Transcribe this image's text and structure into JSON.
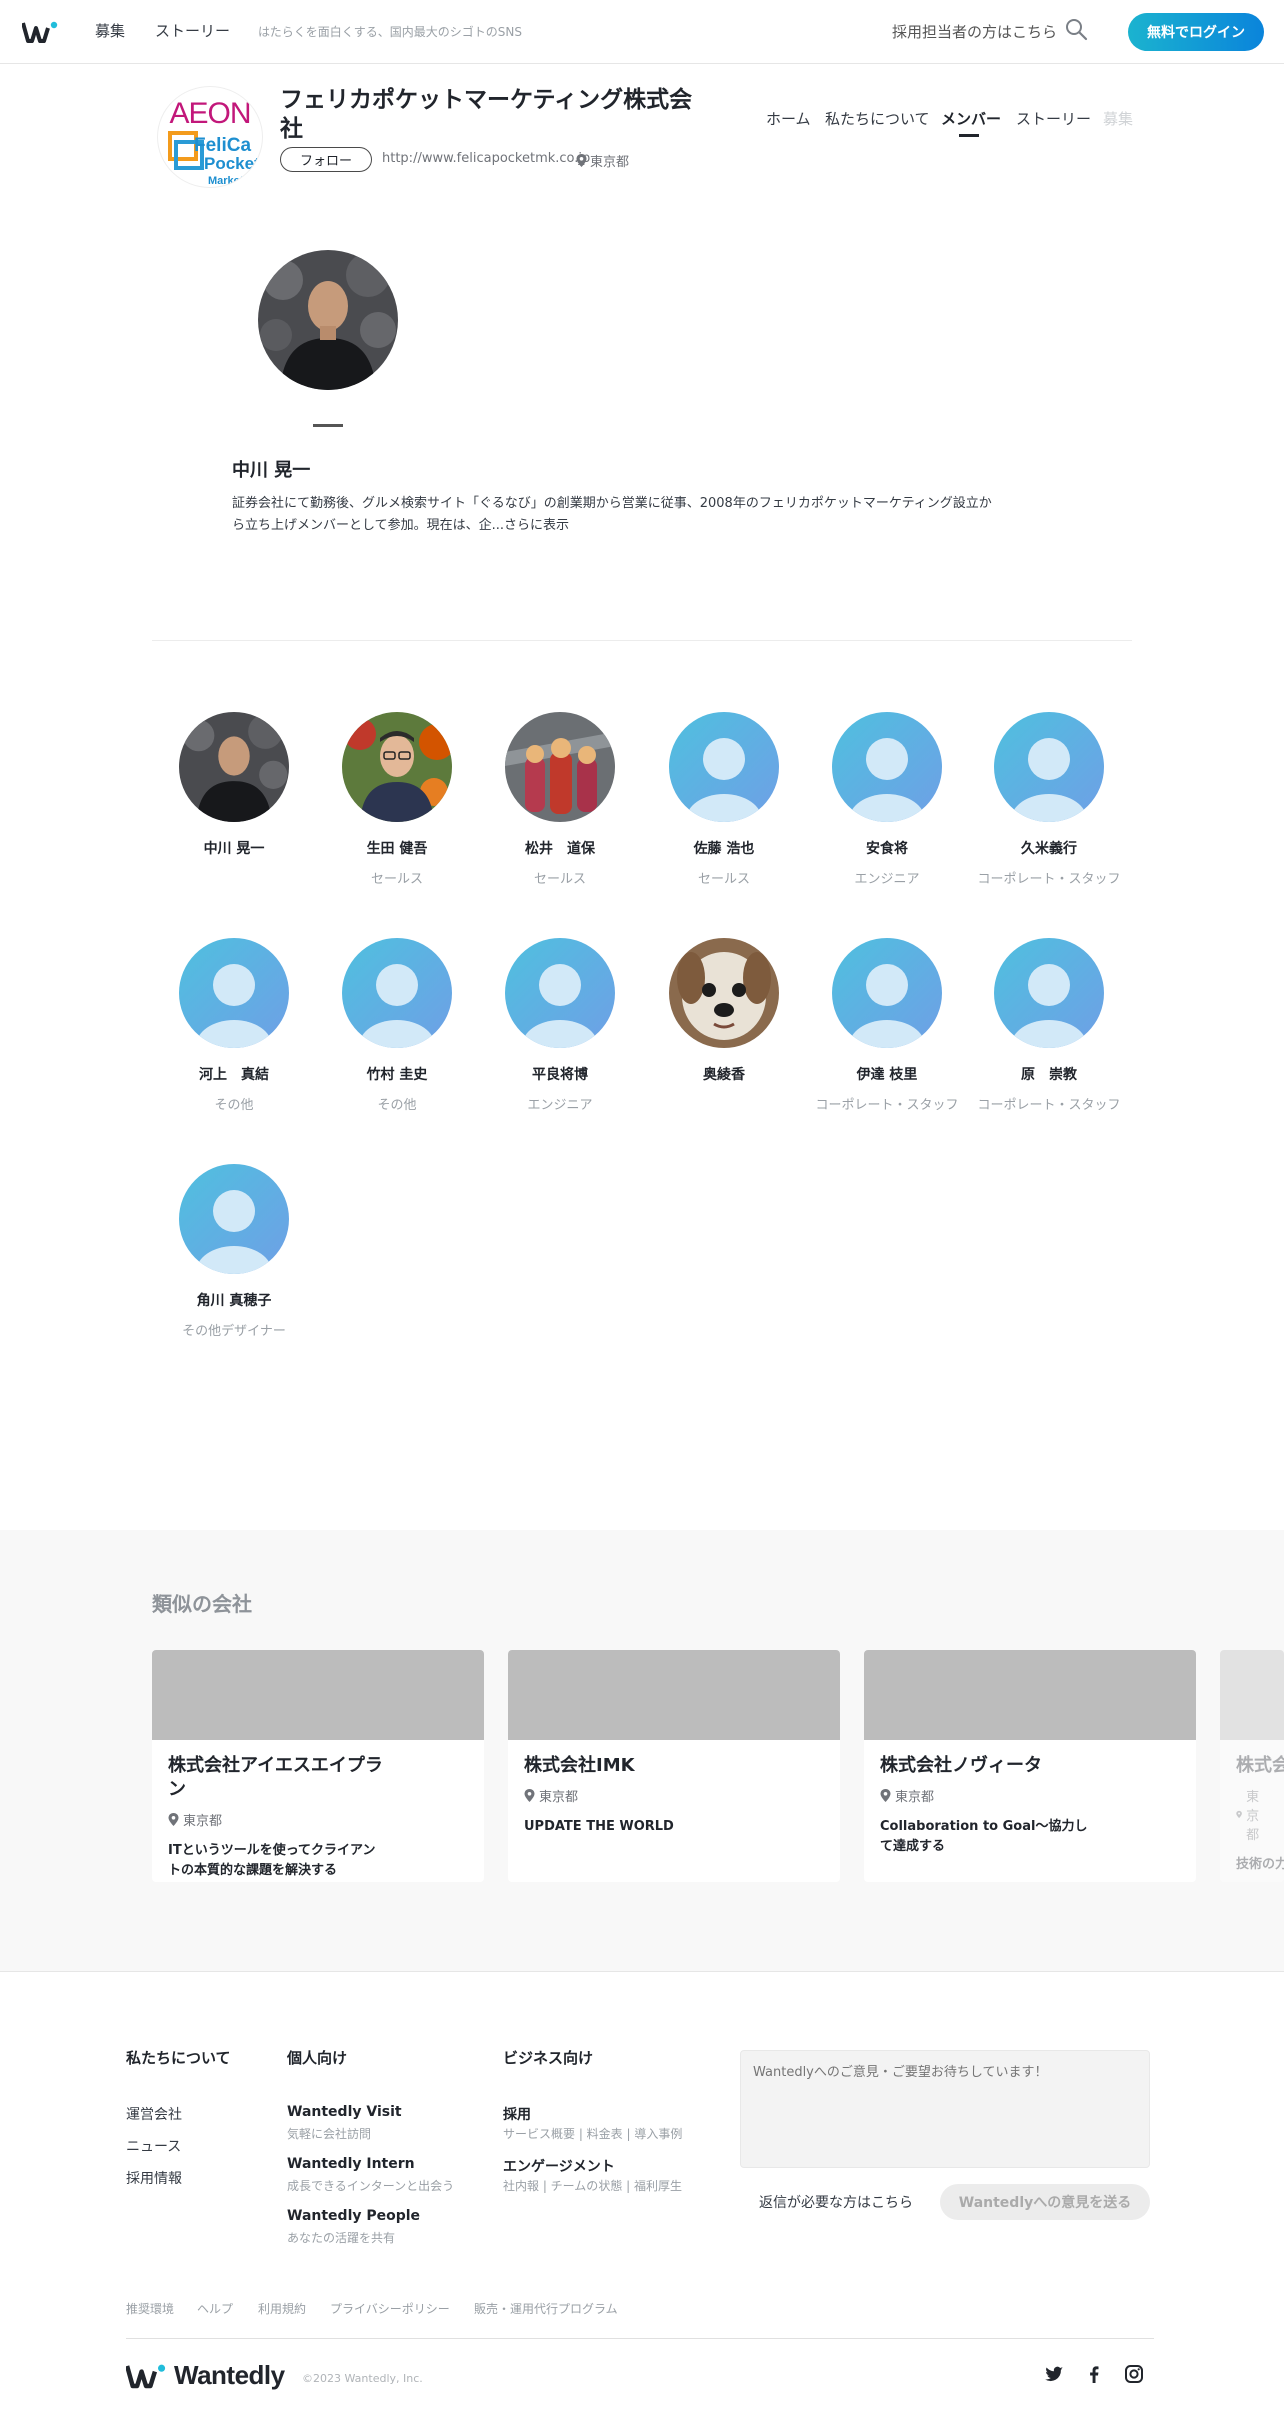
{
  "header": {
    "nav": [
      "募集",
      "ストーリー"
    ],
    "tagline": "はたらくを面白くする、国内最大のシゴトのSNS",
    "recruiter_link": "採用担当者の方はこちら",
    "login": "無料でログイン"
  },
  "company": {
    "logo_text": {
      "top": "AEON",
      "line1": "FeliCa",
      "line2": "Pocket",
      "line3": "Marketing"
    },
    "name": "フェリカポケットマーケティング株式会社",
    "follow": "フォロー",
    "url": "http://www.felicapocketmk.co.jp",
    "location": "東京都",
    "tabs": [
      "ホーム",
      "私たちについて",
      "メンバー",
      "ストーリー",
      "募集"
    ],
    "active_tab": "メンバー"
  },
  "featured": {
    "name": "中川 晃一",
    "bio": "証券会社にて勤務後、グルメ検索サイト「ぐるなび」の創業期から営業に従事、2008年のフェリカポケットマーケティング設立から立ち上げメンバーとして参加。現在は、企...",
    "more": "さらに表示"
  },
  "members": [
    {
      "name": "中川 晃一",
      "role": "",
      "avatar": "photo-man-dark"
    },
    {
      "name": "生田 健吾",
      "role": "セールス",
      "avatar": "photo-man-glasses"
    },
    {
      "name": "松井　道保",
      "role": "セールス",
      "avatar": "photo-figures"
    },
    {
      "name": "佐藤 浩也",
      "role": "セールス",
      "avatar": "default"
    },
    {
      "name": "安食将",
      "role": "エンジニア",
      "avatar": "default"
    },
    {
      "name": "久米義行",
      "role": "コーポレート・スタッフ",
      "avatar": "default"
    },
    {
      "name": "河上　真結",
      "role": "その他",
      "avatar": "default"
    },
    {
      "name": "竹村 圭史",
      "role": "その他",
      "avatar": "default"
    },
    {
      "name": "平良将博",
      "role": "エンジニア",
      "avatar": "default"
    },
    {
      "name": "奥綾香",
      "role": "",
      "avatar": "photo-dog"
    },
    {
      "name": "伊達 枝里",
      "role": "コーポレート・スタッフ",
      "avatar": "default"
    },
    {
      "name": "原　崇教",
      "role": "コーポレート・スタッフ",
      "avatar": "default"
    },
    {
      "name": "角川 真穂子",
      "role": "その他デザイナー",
      "avatar": "default"
    }
  ],
  "similar": {
    "title": "類似の会社",
    "companies": [
      {
        "name": "株式会社アイエスエイプラン",
        "location": "東京都",
        "desc": "ITというツールを使ってクライアントの本質的な課題を解決する"
      },
      {
        "name": "株式会社IMK",
        "location": "東京都",
        "desc": "UPDATE THE WORLD"
      },
      {
        "name": "株式会社ノヴィータ",
        "location": "東京都",
        "desc": "Collaboration to Goal～協力して達成する"
      },
      {
        "name": "株式会社",
        "location": "東京都",
        "desc": "技術の力で社会に貢献したい"
      }
    ]
  },
  "footer": {
    "col1": {
      "title": "私たちについて",
      "links": [
        "運営会社",
        "ニュース",
        "採用情報"
      ]
    },
    "col2": {
      "title": "個人向け",
      "items": [
        {
          "title": "Wantedly Visit",
          "sub": "気軽に会社訪問"
        },
        {
          "title": "Wantedly Intern",
          "sub": "成長できるインターンと出会う"
        },
        {
          "title": "Wantedly People",
          "sub": "あなたの活躍を共有"
        }
      ]
    },
    "col3": {
      "title": "ビジネス向け",
      "items": [
        {
          "title": "採用",
          "sub": "サービス概要 | 料金表 | 導入事例"
        },
        {
          "title": "エンゲージメント",
          "sub": "社内報 | チームの状態 | 福利厚生"
        }
      ]
    },
    "feedback_placeholder": "Wantedlyへのご意見・ご要望お待ちしています！",
    "reply_link": "返信が必要な方はこちら",
    "send": "Wantedlyへの意見を送る",
    "legal": [
      "推奨環境",
      "ヘルプ",
      "利用規約",
      "プライバシーポリシー",
      "販売・運用代行プログラム"
    ],
    "brand": "Wantedly",
    "copyright": "©2023 Wantedly, Inc."
  }
}
